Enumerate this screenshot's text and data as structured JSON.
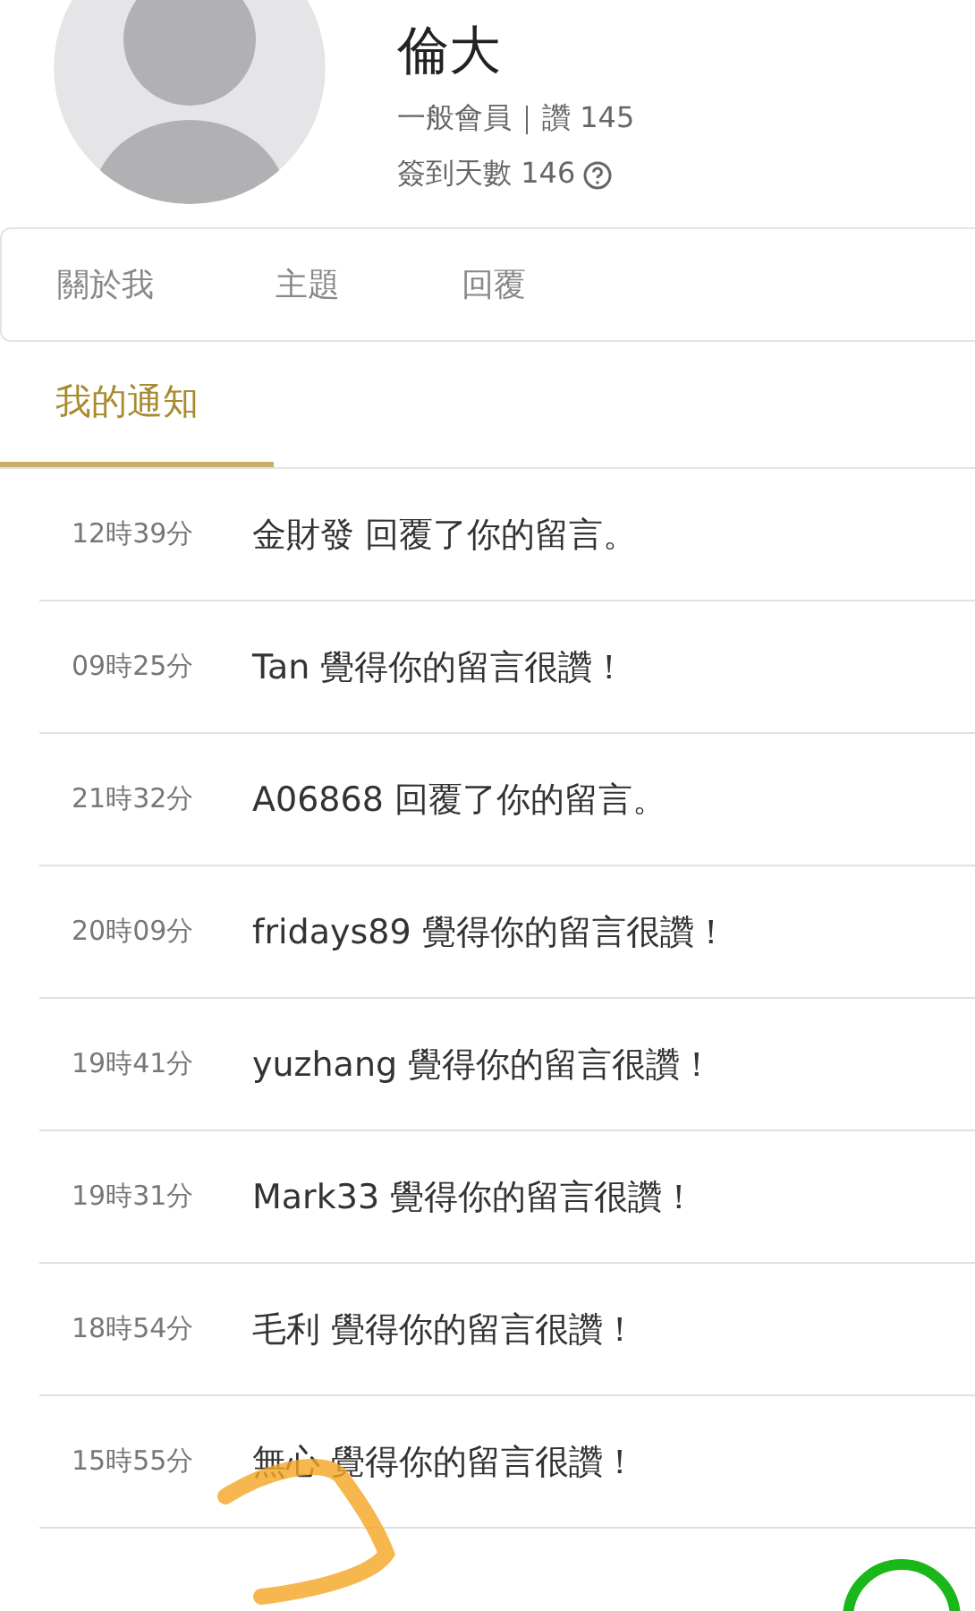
{
  "profile": {
    "name": "倫大",
    "role": "一般會員",
    "likes": "讚 145",
    "checkin": "簽到天數 146"
  },
  "tabs": [
    {
      "label": "關於我",
      "selected": false
    },
    {
      "label": "主題",
      "selected": false
    },
    {
      "label": "回覆",
      "selected": false
    }
  ],
  "section_tab": {
    "label": "我的通知",
    "selected": true
  },
  "notifications": [
    {
      "time": "12時39分",
      "message": "金財發 回覆了你的留言。"
    },
    {
      "time": "09時25分",
      "message": "Tan 覺得你的留言很讚！"
    },
    {
      "time": "21時32分",
      "message": "A06868 回覆了你的留言。"
    },
    {
      "time": "20時09分",
      "message": "fridays89 覺得你的留言很讚！"
    },
    {
      "time": "19時41分",
      "message": "yuzhang 覺得你的留言很讚！"
    },
    {
      "time": "19時31分",
      "message": "Mark33 覺得你的留言很讚！"
    },
    {
      "time": "18時54分",
      "message": "毛利 覺得你的留言很讚！"
    },
    {
      "time": "15時55分",
      "message": "無心 覺得你的留言很讚！"
    }
  ]
}
